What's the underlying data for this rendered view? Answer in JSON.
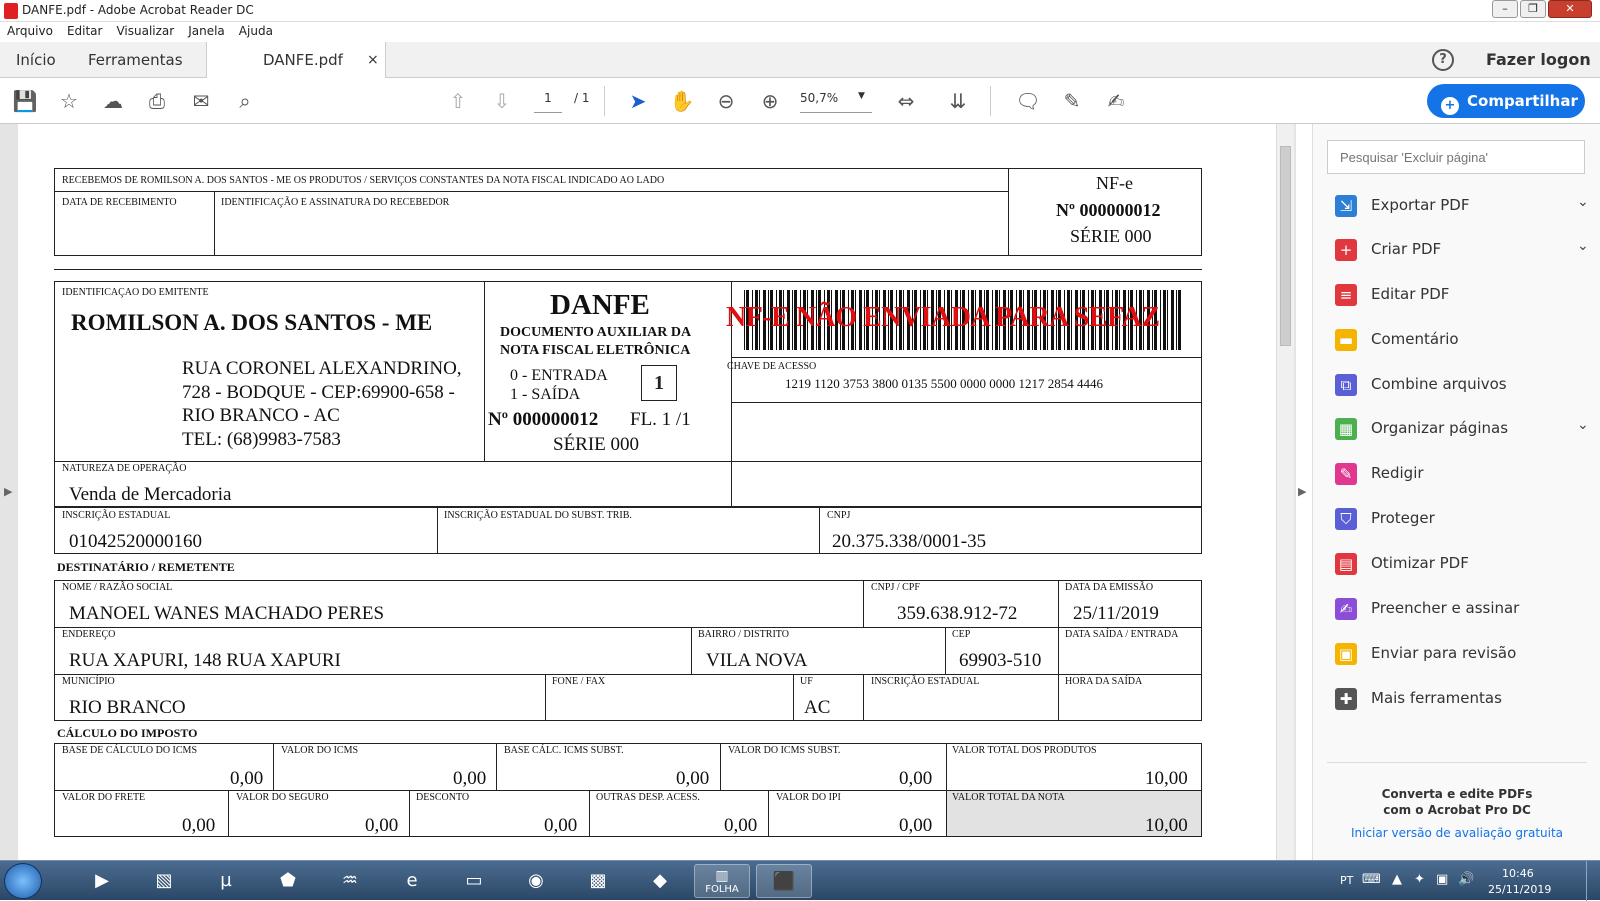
{
  "window": {
    "title": "DANFE.pdf - Adobe Acrobat Reader DC"
  },
  "menu": [
    "Arquivo",
    "Editar",
    "Visualizar",
    "Janela",
    "Ajuda"
  ],
  "tabs": {
    "home": "Início",
    "tools": "Ferramentas",
    "doc": "DANFE.pdf",
    "close": "×"
  },
  "header": {
    "help": "?",
    "login": "Fazer logon"
  },
  "toolbar": {
    "page_current": "1",
    "page_total": "/ 1",
    "zoom": "50,7%",
    "share": "Compartilhar"
  },
  "panel": {
    "search_placeholder": "Pesquisar 'Excluir página'",
    "tools": [
      {
        "label": "Exportar PDF",
        "icon": "export-pdf-icon",
        "color": "#2c7fd4"
      },
      {
        "label": "Criar PDF",
        "icon": "create-pdf-icon",
        "color": "#e0383e"
      },
      {
        "label": "Editar PDF",
        "icon": "edit-pdf-icon",
        "color": "#e0383e"
      },
      {
        "label": "Comentário",
        "icon": "comment-icon",
        "color": "#f4b400"
      },
      {
        "label": "Combine arquivos",
        "icon": "combine-icon",
        "color": "#5b5fd6"
      },
      {
        "label": "Organizar páginas",
        "icon": "organize-icon",
        "color": "#4caf50"
      },
      {
        "label": "Redigir",
        "icon": "redact-icon",
        "color": "#e0388e"
      },
      {
        "label": "Proteger",
        "icon": "protect-icon",
        "color": "#5b5fd6"
      },
      {
        "label": "Otimizar PDF",
        "icon": "optimize-icon",
        "color": "#e0383e"
      },
      {
        "label": "Preencher e assinar",
        "icon": "fill-sign-icon",
        "color": "#8a4fd6"
      },
      {
        "label": "Enviar para revisão",
        "icon": "send-review-icon",
        "color": "#f4b400"
      },
      {
        "label": "Mais ferramentas",
        "icon": "more-tools-icon",
        "color": "#555555"
      }
    ],
    "promo_line1": "Converta e edite PDFs",
    "promo_line2": "com o Acrobat Pro DC",
    "promo_link": "Iniciar versão de avaliação gratuita"
  },
  "danfe": {
    "receipt_text": "RECEBEMOS DE ROMILSON A. DOS SANTOS - ME OS PRODUTOS / SERVIÇOS CONSTANTES DA NOTA FISCAL INDICADO AO LADO",
    "lbl_data_receb": "DATA DE RECEBIMENTO",
    "lbl_ident_ass": "IDENTIFICAÇÃO E ASSINATURA DO RECEBEDOR",
    "nfe": "NF-e",
    "nfe_number": "Nº 000000012",
    "nfe_serie": "SÉRIE 000",
    "lbl_ident_emit": "IDENTIFICAÇAO DO EMITENTE",
    "emitente": "ROMILSON A. DOS SANTOS - ME",
    "addr1": "RUA CORONEL ALEXANDRINO,",
    "addr2": "728  - BODQUE - CEP:69900-658 -",
    "addr3": "RIO BRANCO - AC",
    "addr4": "TEL: (68)9983-7583",
    "danfe_title": "DANFE",
    "danfe_sub1": "DOCUMENTO AUXILIAR DA",
    "danfe_sub2": "NOTA FISCAL ELETRÔNICA",
    "entrada": "0 - ENTRADA",
    "saida": "1 - SAÍDA",
    "tipo": "1",
    "danfe_number": "Nº 000000012",
    "folha": "FL. 1 /1",
    "danfe_serie": "SÉRIE 000",
    "warning": "NF-E NÃO ENVIADA PARA SEFAZ",
    "lbl_chave": "CHAVE DE ACESSO",
    "chave": "1219 1120 3753 3800 0135 5500 0000 0000 1217 2854 4446",
    "lbl_natureza": "NATUREZA DE OPERAÇÃO",
    "natureza": "Venda de Mercadoria",
    "lbl_ie": "INSCRIÇÃO ESTADUAL",
    "ie": "01042520000160",
    "lbl_ie_st": "INSCRIÇÃO ESTADUAL DO SUBST. TRIB.",
    "lbl_cnpj": "CNPJ",
    "cnpj": "20.375.338/0001-35",
    "sect_dest": "DESTINATÁRIO / REMETENTE",
    "lbl_nome": "NOME / RAZÃO SOCIAL",
    "nome": "MANOEL WANES MACHADO PERES",
    "lbl_cnpj_cpf": "CNPJ / CPF",
    "cpf": "359.638.912-72",
    "lbl_data_emissao": "DATA DA EMISSÃO",
    "data_emissao": "25/11/2019",
    "lbl_endereco": "ENDEREÇO",
    "endereco": "RUA XAPURI, 148 RUA XAPURI",
    "lbl_bairro": "BAIRRO / DISTRITO",
    "bairro": "VILA NOVA",
    "lbl_cep": "CEP",
    "cep": "69903-510",
    "lbl_data_saida": "DATA SAÍDA / ENTRADA",
    "lbl_municipio": "MUNICÍPIO",
    "municipio": "RIO BRANCO",
    "lbl_fone": "FONE / FAX",
    "lbl_uf": "UF",
    "uf": "AC",
    "lbl_ie_dest": "INSCRIÇÃO ESTADUAL",
    "lbl_hora_saida": "HORA DA SAÍDA",
    "sect_calc": "CÁLCULO DO IMPOSTO",
    "lbl_base_icms": "BASE DE CÁLCULO DO ICMS",
    "base_icms": "0,00",
    "lbl_valor_icms": "VALOR DO ICMS",
    "valor_icms": "0,00",
    "lbl_base_st": "BASE CÁLC. ICMS SUBST.",
    "base_st": "0,00",
    "lbl_valor_st": "VALOR DO ICMS SUBST.",
    "valor_st": "0,00",
    "lbl_total_prod": "VALOR TOTAL DOS PRODUTOS",
    "total_prod": "10,00",
    "lbl_frete": "VALOR DO FRETE",
    "frete": "0,00",
    "lbl_seguro": "VALOR DO SEGURO",
    "seguro": "0,00",
    "lbl_desconto": "DESCONTO",
    "desconto": "0,00",
    "lbl_outras": "OUTRAS DESP. ACESS.",
    "outras": "0,00",
    "lbl_ipi": "VALOR DO IPI",
    "ipi": "0,00",
    "lbl_total_nota": "VALOR TOTAL DA NOTA",
    "total_nota": "10,00"
  },
  "taskbar": {
    "lang": "PT",
    "time": "10:46",
    "date": "25/11/2019",
    "folha": "FOLHA"
  }
}
